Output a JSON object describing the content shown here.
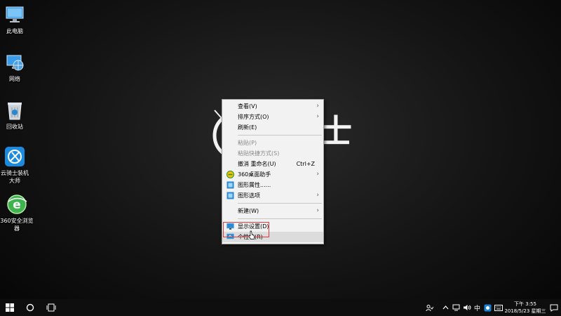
{
  "desktop": {
    "icons": [
      {
        "label": "此电脑",
        "icon": "computer-icon"
      },
      {
        "label": "网络",
        "icon": "network-icon"
      },
      {
        "label": "回收站",
        "icon": "recycle-bin-icon"
      },
      {
        "label": "云骑士装机大师",
        "icon": "yunqishi-icon"
      },
      {
        "label": "360安全浏览器",
        "icon": "browser-360-icon"
      }
    ],
    "wallpaper_text": "士"
  },
  "context_menu": {
    "items": [
      {
        "label": "查看(V)"
      },
      {
        "label": "排序方式(O)"
      },
      {
        "label": "刷新(E)"
      },
      {
        "label": "粘贴(P)"
      },
      {
        "label": "粘贴快捷方式(S)"
      },
      {
        "label": "撤消 重命名(U)",
        "shortcut": "Ctrl+Z"
      },
      {
        "label": "360桌面助手"
      },
      {
        "label": "图形属性......"
      },
      {
        "label": "图形选项"
      },
      {
        "label": "新建(W)"
      },
      {
        "label": "显示设置(D)"
      },
      {
        "label": "个性化(R)"
      }
    ]
  },
  "taskbar": {
    "tray": {
      "ime_label": "中",
      "time": "下午 3:55",
      "date": "2018/5/23 星期三"
    }
  },
  "colors": {
    "highlight_box": "#e23a3a",
    "menu_bg": "#f2f2f2",
    "taskbar_bg": "#0e0e0e"
  }
}
